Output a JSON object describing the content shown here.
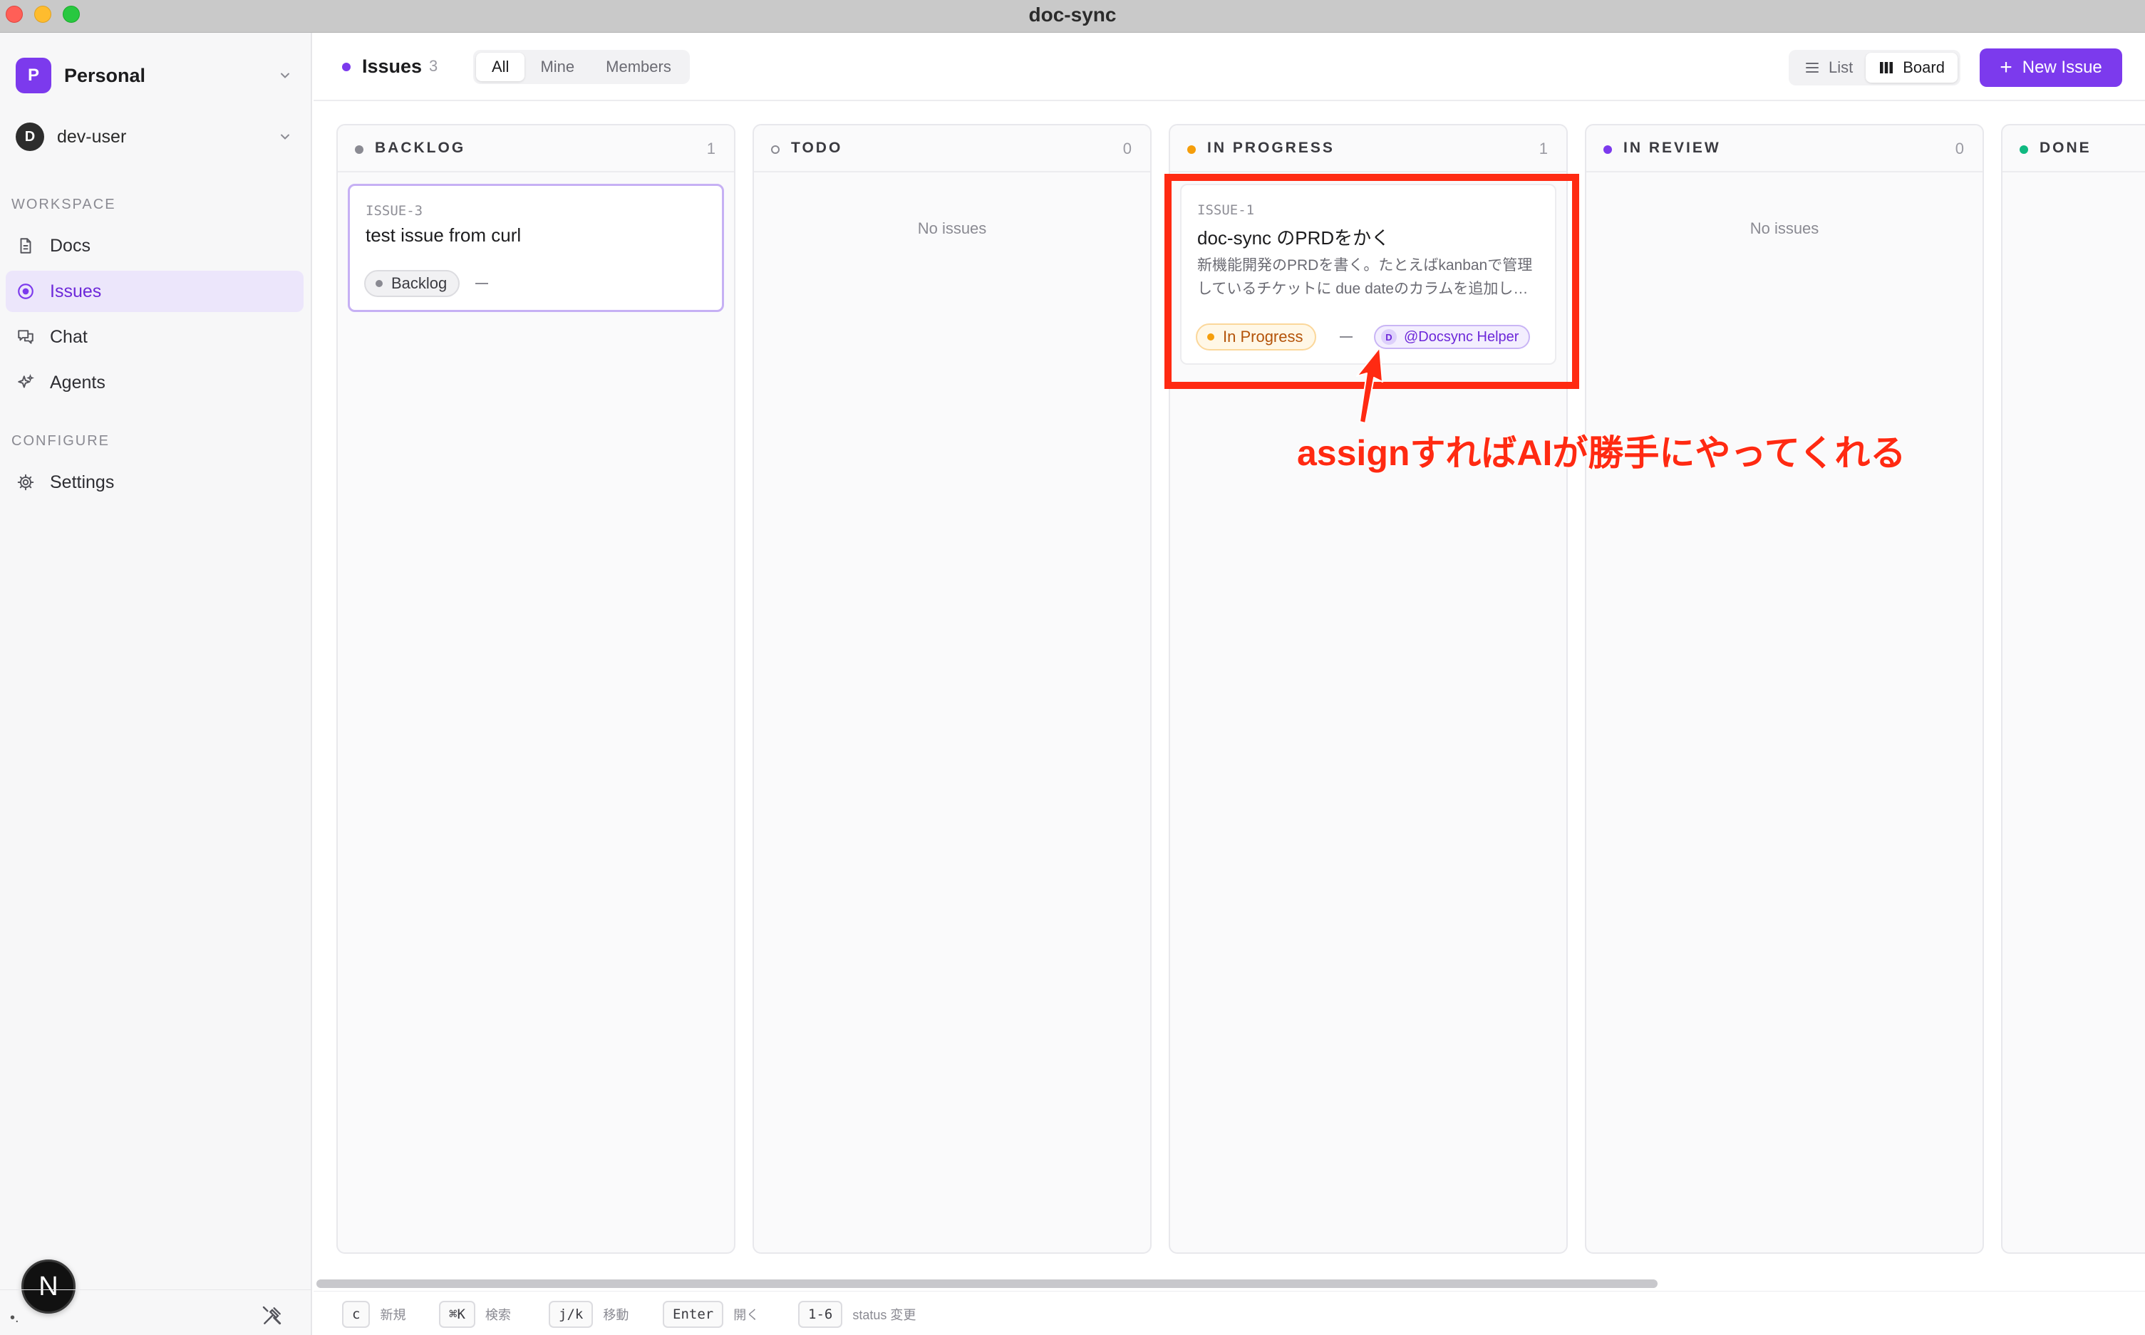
{
  "window": {
    "title": "doc-sync"
  },
  "sidebar": {
    "workspace": {
      "initial": "P",
      "name": "Personal"
    },
    "user": {
      "initial": "D",
      "name": "dev-user"
    },
    "sections": [
      {
        "label": "WORKSPACE",
        "items": [
          {
            "label": "Docs",
            "icon": "document-icon",
            "active": false
          },
          {
            "label": "Issues",
            "icon": "issues-icon",
            "active": true
          },
          {
            "label": "Chat",
            "icon": "chat-icon",
            "active": false
          },
          {
            "label": "Agents",
            "icon": "agents-icon",
            "active": false
          }
        ]
      },
      {
        "label": "CONFIGURE",
        "items": [
          {
            "label": "Settings",
            "icon": "gear-icon",
            "active": false
          }
        ]
      }
    ],
    "badge": "N",
    "bottom_dot": "•."
  },
  "header": {
    "title": "Issues",
    "count": "3",
    "filters": [
      "All",
      "Mine",
      "Members"
    ],
    "active_filter": "All",
    "views": [
      "List",
      "Board"
    ],
    "active_view": "Board",
    "new_button": "New Issue"
  },
  "columns": [
    {
      "title": "BACKLOG",
      "count": "1",
      "empty_text": ""
    },
    {
      "title": "TODO",
      "count": "0",
      "empty_text": "No issues"
    },
    {
      "title": "IN PROGRESS",
      "count": "1",
      "empty_text": ""
    },
    {
      "title": "IN REVIEW",
      "count": "0",
      "empty_text": "No issues"
    },
    {
      "title": "DONE",
      "count": "",
      "empty_text": ""
    }
  ],
  "cards": {
    "backlog": {
      "id": "ISSUE-3",
      "title": "test issue from curl",
      "status": "Backlog"
    },
    "in_progress": {
      "id": "ISSUE-1",
      "title": "doc-sync のPRDをかく",
      "desc_line1": "新機能開発のPRDを書く。たとえばkanbanで管理",
      "desc_line2": "しているチケットに due dateのカラムを追加し…",
      "status": "In Progress",
      "assignee_initial": "D",
      "assignee": "@Docsync Helper"
    }
  },
  "annotation": {
    "text": "assignすればAIが勝手にやってくれる"
  },
  "colors": {
    "accent": "#7c3aed",
    "backlog": "#8a8a92",
    "in_progress": "#f59e0b",
    "in_review": "#7c3aed",
    "done": "#10b981",
    "annotation": "#ff2a12"
  },
  "shortcuts": [
    {
      "key": "c",
      "label": "新規"
    },
    {
      "key": "⌘K",
      "label": "検索"
    },
    {
      "key": "j/k",
      "label": "移動"
    },
    {
      "key": "Enter",
      "label": "開く"
    },
    {
      "key": "1-6",
      "label": "status 変更"
    }
  ]
}
